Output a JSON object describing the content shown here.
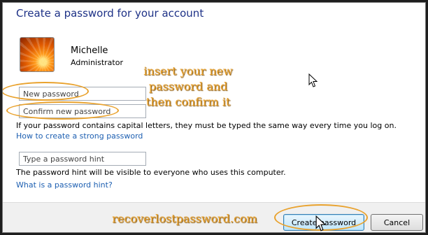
{
  "title": "Create a password for your account",
  "user": {
    "name": "Michelle",
    "role": "Administrator"
  },
  "fields": {
    "new_password_placeholder": "New password",
    "confirm_password_placeholder": "Confirm new password",
    "hint_placeholder": "Type a password hint"
  },
  "notes": {
    "capital_letters": "If your password contains capital letters, they must be typed the same way every time you log on.",
    "hint_visible": "The password hint will be visible to everyone who uses this computer."
  },
  "links": {
    "strong_password": "How to create a strong password",
    "what_is_hint": "What is a password hint?"
  },
  "annotation": {
    "line1": "insert your new",
    "line2": "password and",
    "line3": "then confirm it",
    "watermark": "recoverlostpassword.com"
  },
  "buttons": {
    "create": "Create password",
    "cancel": "Cancel"
  },
  "colors": {
    "title": "#1e3287",
    "link": "#1d5fb1",
    "annotation": "#e9a22d"
  },
  "icons": [
    "user-avatar",
    "mouse-cursor-icon"
  ]
}
